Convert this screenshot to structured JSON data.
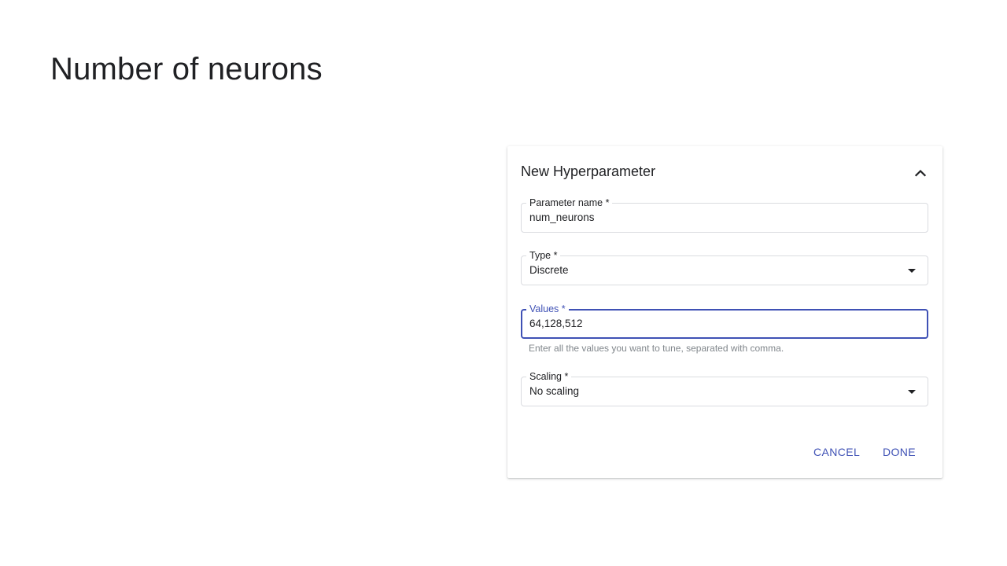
{
  "slide": {
    "title": "Number of neurons"
  },
  "dialog": {
    "title": "New Hyperparameter",
    "collapse_icon": "chevron-up-icon",
    "fields": {
      "parameter_name": {
        "label": "Parameter name *",
        "value": "num_neurons"
      },
      "type": {
        "label": "Type *",
        "value": "Discrete"
      },
      "values": {
        "label": "Values *",
        "value": "64,128,512",
        "hint": "Enter all the values you want to tune, separated with comma."
      },
      "scaling": {
        "label": "Scaling *",
        "value": "No scaling"
      }
    },
    "buttons": {
      "cancel": "CANCEL",
      "done": "DONE"
    }
  },
  "colors": {
    "accent": "#3f51b5",
    "text": "#202124",
    "hint": "#80868b",
    "border": "#dadce0"
  }
}
